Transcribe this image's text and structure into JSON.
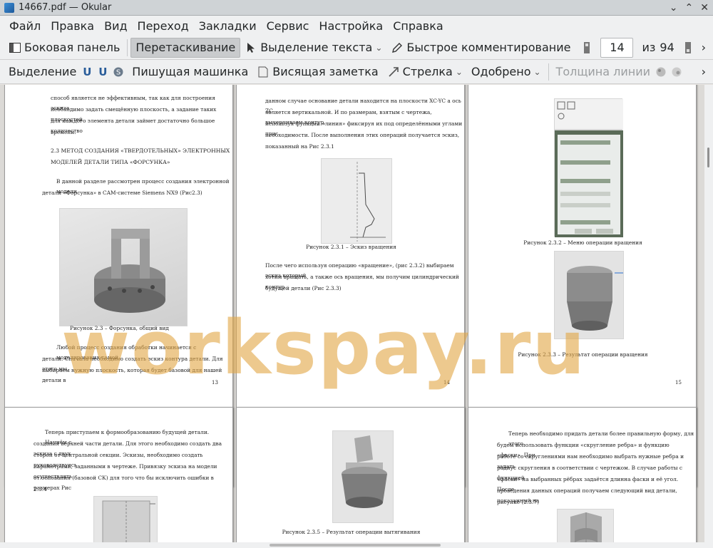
{
  "window": {
    "title": "14667.pdf — Okular",
    "minimize": "⌄",
    "maximize": "⌃",
    "close": "✕"
  },
  "menu": [
    "Файл",
    "Правка",
    "Вид",
    "Переход",
    "Закладки",
    "Сервис",
    "Настройка",
    "Справка"
  ],
  "toolbar1": {
    "sidebar": "Боковая панель",
    "drag": "Перетаскивание",
    "text_select": "Выделение текста",
    "quick_annot": "Быстрое комментирование",
    "page_value": "14",
    "page_of": "из",
    "page_total": "94"
  },
  "toolbar2": {
    "selection": "Выделение",
    "typewriter": "Пишущая машинка",
    "note": "Висящая заметка",
    "arrow": "Стрелка",
    "approved": "Одобрено",
    "line_width": "Толщина линии"
  },
  "pages": {
    "p13": {
      "t1": "способ является не эффективным, так как для построения эскиза",
      "t2": "необходимо задать смещённую плоскость, а задание таких плоскостей",
      "t3": "для каждого элемента детали займет достаточно большое количество",
      "t4": "времени.",
      "h1": "2.3 МЕТОД СОЗДАНИЯ «ТВЕРДОТЕЛЬНЫХ» ЭЛЕКТРОННЫХ",
      "h2": "МОДЕЛЕЙ ДЕТАЛИ ТИПА «ФОРСУНКА»",
      "t5": "В данной разделе рассмотрен процесс создания электронной модели",
      "t6": "детали «Форсунка» в CAM-системе Siemens NX9 (Рис2.3)",
      "cap": "Рисунок 2.3 – Форсунка, общий вид",
      "t7": "Любой процесс создания обработки начинается с моделирования самой",
      "t8": "детали. Сначала необходимо создать эскиз контура детали. Для этого мы",
      "t9": "выбираем нужную плоскость, которая будет базовой для нашей детали в",
      "num": "13"
    },
    "p14": {
      "t1": "данном случае основание детали находится на плоскости XC-YC а ось ZC",
      "t2": "является вертикальной. И по размерам, взятым с чертежа, вычерчиваем контур,",
      "t3": "используя функции «линия» фиксируя их под определёнными углами при",
      "t4": "необходимости. После выполнения этих операций получается эскиз,",
      "t5": "показанный на Рис 2.3.1",
      "cap": "Рисунок 2.3.1 – Эскиз вращения",
      "t6": "После чего используя операцию «вращение», (рис 2.3.2) выбираем эскиз который",
      "t7": "хотим вращать, а также ось вращения, мы получим цилиндрический контур",
      "t8": "будущей детали (Рис 2.3.3)",
      "num": "14"
    },
    "p15": {
      "cap1": "Рисунок 2.3.2 – Меню операции вращения",
      "cap2": "Рисунок 2.3.3 – Результат операции вращения",
      "num": "15"
    },
    "p16": {
      "t1": "Теперь приступаем к формообразованию будущей детали. Начнём с",
      "t2": "создания верхней части детали. Для этого необходимо создать два эскиза с двух",
      "t3": "сторон от центральной секции. Эскизы, необходимо создать руководствуясь",
      "t4": "параметрами, заданными в чертеже. Привязку эскиза на модели осуществлять",
      "t5": "от основания (базовой СК) для того что бы исключить ошибки в размерах Рис",
      "t6": "2.3.4"
    },
    "p17": {
      "cap": "Рисунок 2.3.5 – Результат операции вытягивания"
    },
    "p18": {
      "t1": "Теперь необходимо придать детали более правильную форму, для этого",
      "t2": "будем использовать функции «скругление ребра» и функцию «фаски». При",
      "t3": "работе со скруглениями нам необходимо выбрать нужные ребра и задать",
      "t4": "радиус скругления в соответствии с чертежом. В случае работы с функцией",
      "t5": "«фаски» на выбранных рёбрах задаётся длинна фаски и её угол. После",
      "t6": "проведения данных операций получаем следующий вид детали, показанный на",
      "t7": "рисунке (2.3.7)"
    }
  },
  "watermark": "workspay.ru"
}
